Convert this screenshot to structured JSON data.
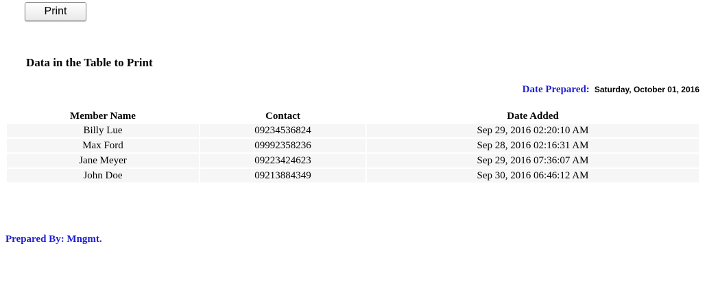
{
  "print_button": {
    "label": "Print"
  },
  "heading": "Data in the Table to Print",
  "date_prepared": {
    "label": "Date Prepared:",
    "value": "Saturday, October 01, 2016"
  },
  "table": {
    "headers": [
      "Member Name",
      "Contact",
      "Date Added"
    ],
    "rows": [
      [
        "Billy Lue",
        "09234536824",
        "Sep 29, 2016 02:20:10 AM"
      ],
      [
        "Max Ford",
        "09992358236",
        "Sep 28, 2016 02:16:31 AM"
      ],
      [
        "Jane Meyer",
        "09223424623",
        "Sep 29, 2016 07:36:07 AM"
      ],
      [
        "John Doe",
        "09213884349",
        "Sep 30, 2016 06:46:12 AM"
      ]
    ]
  },
  "prepared_by": "Prepared By: Mngmt.",
  "colors": {
    "label_blue": "#1f1fd6",
    "row_background": "#f6f6f6"
  }
}
